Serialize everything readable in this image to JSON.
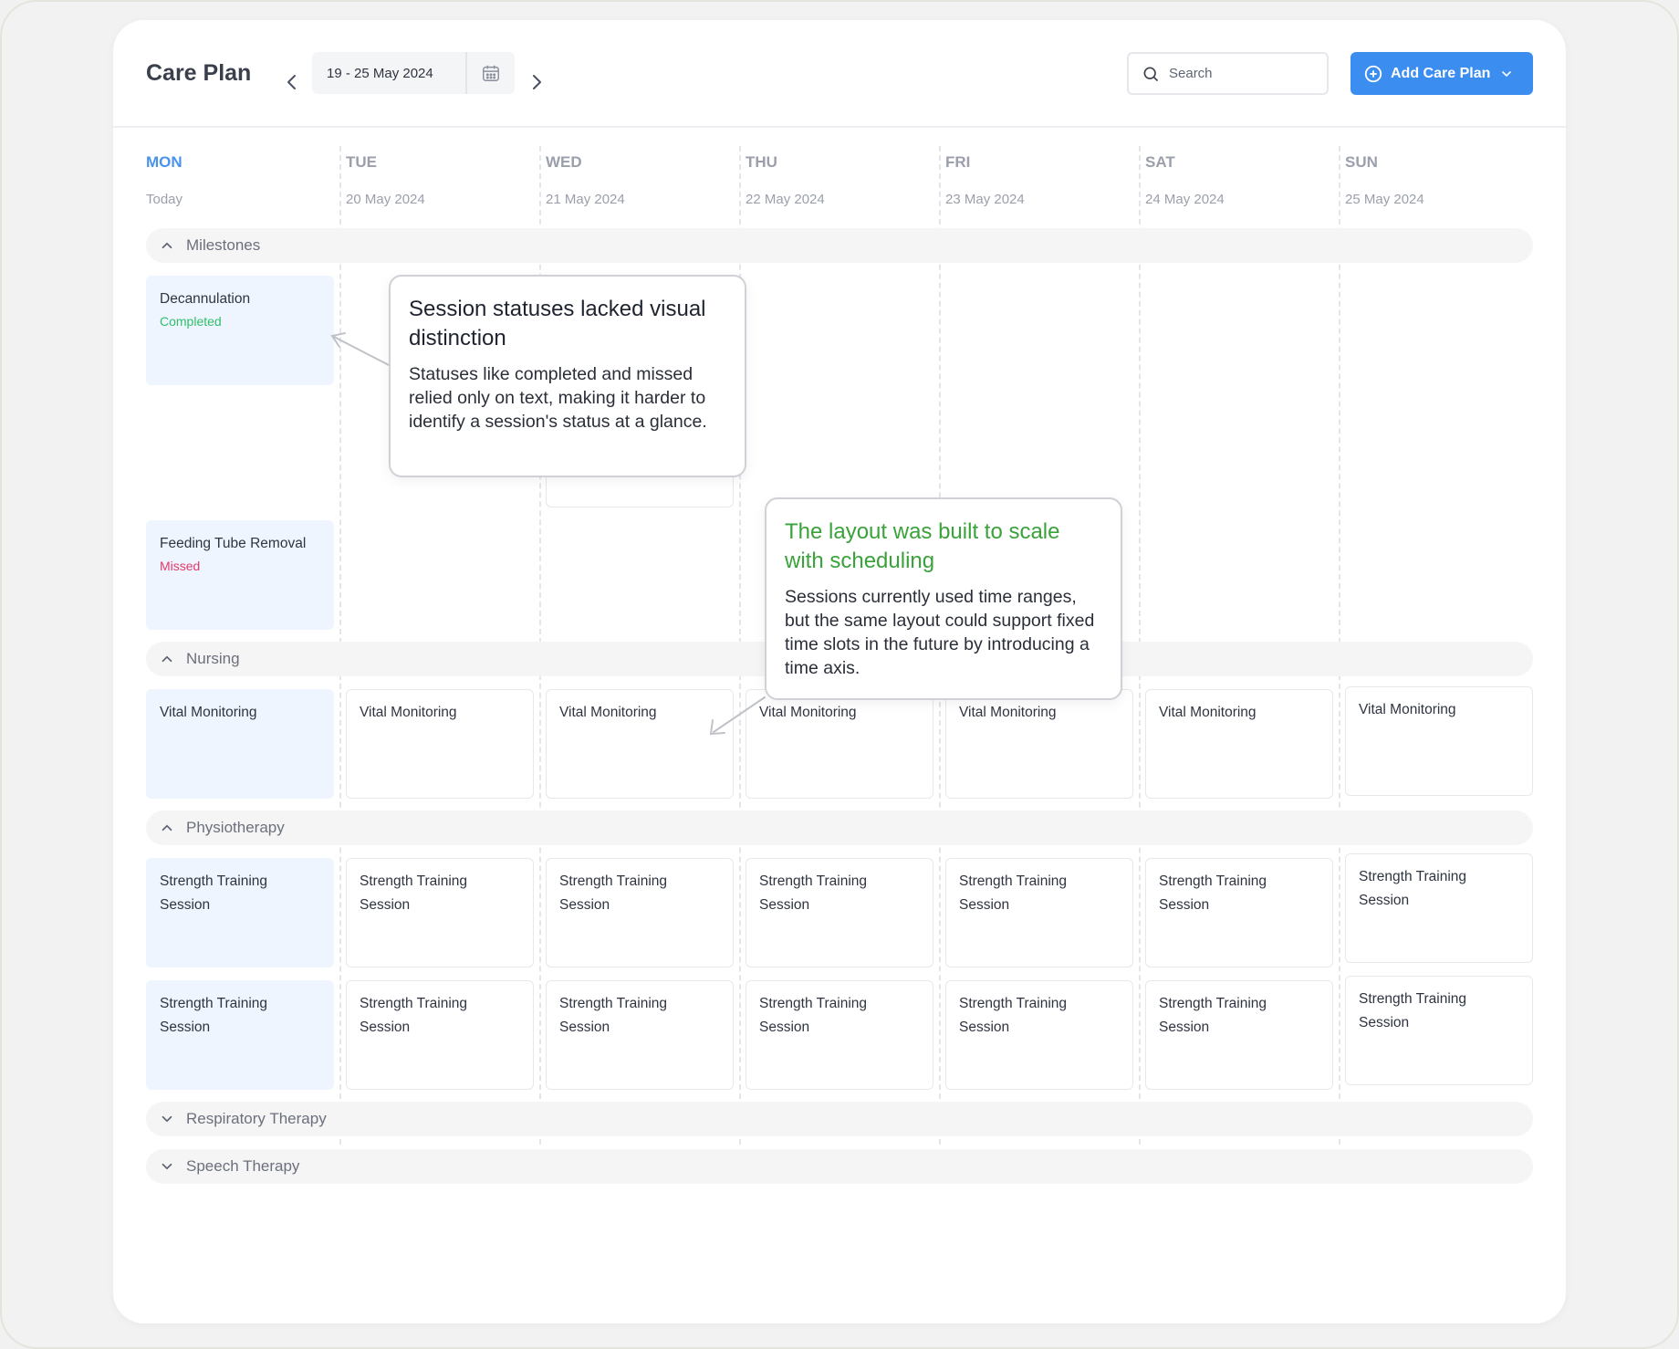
{
  "header": {
    "title": "Care Plan",
    "date_range": "19 - 25  May 2024",
    "search_placeholder": "Search",
    "add_button_label": "Add Care Plan"
  },
  "days": [
    {
      "name": "MON",
      "date": "Today"
    },
    {
      "name": "TUE",
      "date": "20 May 2024"
    },
    {
      "name": "WED",
      "date": "21 May 2024"
    },
    {
      "name": "THU",
      "date": "22 May 2024"
    },
    {
      "name": "FRI",
      "date": "23 May 2024"
    },
    {
      "name": "SAT",
      "date": "24 May 2024"
    },
    {
      "name": "SUN",
      "date": "25 May 2024"
    }
  ],
  "sections": {
    "milestones": "Milestones",
    "nursing": "Nursing",
    "physiotherapy": "Physiotherapy",
    "respiratory": "Respiratory Therapy",
    "speech": "Speech Therapy"
  },
  "milestones": [
    {
      "title": "Decannulation",
      "status": "Completed"
    },
    {
      "title": "Feeding Tube Removal",
      "status": "Missed"
    }
  ],
  "nursing_item": "Vital Monitoring",
  "physio_item": "Strength Training Session",
  "callouts": [
    {
      "title": "Session statuses lacked visual distinction",
      "body": "Statuses like completed and missed relied only on text, making it harder to identify a session's status at a glance."
    },
    {
      "title": "The layout was built to scale with scheduling",
      "body": "Sessions currently used time ranges, but the same layout could support fixed time slots in the future by introducing a time axis."
    }
  ],
  "colors": {
    "accent": "#3b8ef0",
    "today": "#4a93ec",
    "completed": "#2fbf6a",
    "missed": "#e03a6a",
    "callout_green_title": "#3aa23a"
  },
  "icons": {
    "prev": "chevron-left-icon",
    "next": "chevron-right-icon",
    "calendar": "calendar-icon",
    "search": "search-icon",
    "add": "plus-circle-icon",
    "dropdown": "chevron-down-icon"
  }
}
